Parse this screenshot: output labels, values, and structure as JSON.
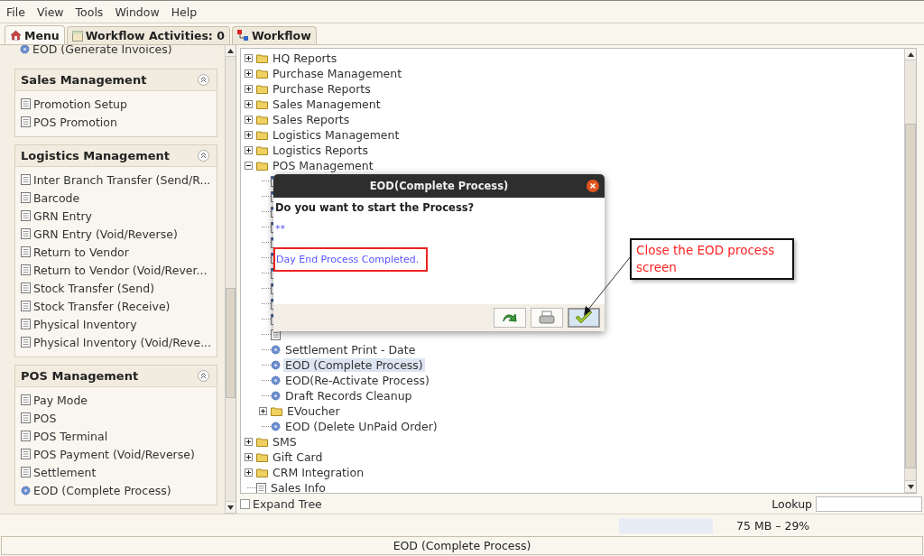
{
  "menu_bar": [
    {
      "label": "File"
    },
    {
      "label": "View"
    },
    {
      "label": "Tools"
    },
    {
      "label": "Window"
    },
    {
      "label": "Help"
    }
  ],
  "tabs": [
    {
      "label": "Menu",
      "kind": "home",
      "selected": true
    },
    {
      "label": "Workflow Activities: 0",
      "kind": "list",
      "selected": false
    },
    {
      "label": "Workflow",
      "kind": "flow",
      "selected": false
    }
  ],
  "sidebar": {
    "top_item": {
      "label": "EOD (Generate Invoices)",
      "kind": "process"
    },
    "sections": [
      {
        "title": "Sales Management",
        "items": [
          {
            "label": "Promotion Setup",
            "kind": "doc"
          },
          {
            "label": "POS Promotion",
            "kind": "doc"
          }
        ]
      },
      {
        "title": "Logistics Management",
        "items": [
          {
            "label": "Inter Branch Transfer (Send/R...",
            "kind": "doc"
          },
          {
            "label": "Barcode",
            "kind": "doc"
          },
          {
            "label": "GRN Entry",
            "kind": "doc"
          },
          {
            "label": "GRN Entry (Void/Reverse)",
            "kind": "doc"
          },
          {
            "label": "Return to Vendor",
            "kind": "doc"
          },
          {
            "label": "Return to Vendor (Void/Rever...",
            "kind": "doc"
          },
          {
            "label": "Stock Transfer (Send)",
            "kind": "doc"
          },
          {
            "label": "Stock Transfer (Receive)",
            "kind": "doc"
          },
          {
            "label": "Physical Inventory",
            "kind": "doc"
          },
          {
            "label": "Physical Inventory (Void/Reve...",
            "kind": "doc"
          }
        ]
      },
      {
        "title": "POS Management",
        "items": [
          {
            "label": "Pay Mode",
            "kind": "doc"
          },
          {
            "label": "POS",
            "kind": "doc"
          },
          {
            "label": "POS Terminal",
            "kind": "doc"
          },
          {
            "label": "POS Payment (Void/Reverse)",
            "kind": "doc"
          },
          {
            "label": "Settlement",
            "kind": "doc"
          },
          {
            "label": "EOD (Complete Process)",
            "kind": "process"
          }
        ]
      }
    ]
  },
  "tree": [
    {
      "label": "HQ Reports",
      "kind": "folder",
      "expanded": false,
      "selected": false
    },
    {
      "label": "Purchase Management",
      "kind": "folder",
      "expanded": false,
      "selected": false
    },
    {
      "label": "Purchase Reports",
      "kind": "folder",
      "expanded": false,
      "selected": false
    },
    {
      "label": "Sales Management",
      "kind": "folder",
      "expanded": false,
      "selected": false
    },
    {
      "label": "Sales Reports",
      "kind": "folder",
      "expanded": false,
      "selected": false
    },
    {
      "label": "Logistics Management",
      "kind": "folder",
      "expanded": false,
      "selected": false
    },
    {
      "label": "Logistics Reports",
      "kind": "folder",
      "expanded": false,
      "selected": false
    },
    {
      "label": "POS Management",
      "kind": "folder",
      "expanded": true,
      "selected": false,
      "children": [
        {
          "kind": "report"
        },
        {
          "kind": "report"
        },
        {
          "kind": "report"
        },
        {
          "kind": "report"
        },
        {
          "kind": "report"
        },
        {
          "kind": "report"
        },
        {
          "kind": "report"
        },
        {
          "kind": "report"
        },
        {
          "kind": "report"
        },
        {
          "kind": "report"
        },
        {
          "kind": "doc"
        },
        {
          "label": "Settlement Print - Date",
          "kind": "process",
          "selected": false
        },
        {
          "label": "EOD (Complete Process)",
          "kind": "process",
          "selected": true
        },
        {
          "label": "EOD(Re-Activate Process)",
          "kind": "process",
          "selected": false
        },
        {
          "label": "Draft Records Cleanup",
          "kind": "process",
          "selected": false
        },
        {
          "label": "EVoucher",
          "kind": "folder",
          "expanded": false,
          "selected": false
        },
        {
          "label": "EOD (Delete UnPaid Order)",
          "kind": "process",
          "selected": false
        }
      ]
    },
    {
      "label": "SMS",
      "kind": "folder",
      "expanded": false,
      "selected": false
    },
    {
      "label": "Gift Card",
      "kind": "folder",
      "expanded": false,
      "selected": false
    },
    {
      "label": "CRM Integration",
      "kind": "folder",
      "expanded": false,
      "selected": false
    },
    {
      "label": "Sales Info",
      "kind": "doc",
      "selected": false
    }
  ],
  "expand_tree": {
    "label": "Expand Tree",
    "checked": false
  },
  "lookup": {
    "label": "Lookup"
  },
  "memory": "75 MB – 29%",
  "status_bar": "EOD (Complete Process)",
  "dialog": {
    "title": "EOD(Complete Process)",
    "question": "Do you want to start the Process?",
    "marker": "**",
    "message": "Day End Process Completed.",
    "buttons": [
      {
        "kind": "redo"
      },
      {
        "kind": "print"
      },
      {
        "kind": "ok"
      }
    ]
  },
  "callout": "Close the EOD process screen"
}
